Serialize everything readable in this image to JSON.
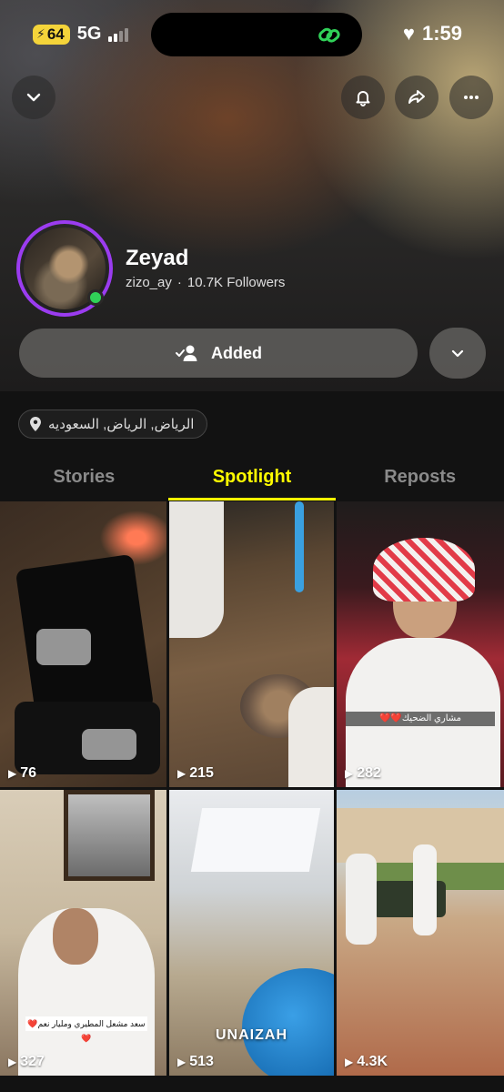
{
  "status_bar": {
    "battery": "64",
    "network": "5G",
    "time": "1:59"
  },
  "profile": {
    "name": "Zeyad",
    "username": "zizo_ay",
    "separator": "·",
    "followers": "10.7K Followers",
    "online": true
  },
  "actions": {
    "added_label": "Added"
  },
  "location": {
    "text": "الرياض, الرياض, السعوديه"
  },
  "tabs": [
    {
      "label": "Stories",
      "active": false
    },
    {
      "label": "Spotlight",
      "active": true
    },
    {
      "label": "Reposts",
      "active": false
    }
  ],
  "spotlight": [
    {
      "views": "76"
    },
    {
      "views": "215"
    },
    {
      "views": "282",
      "caption": "مشاري الضحيك❤️❤️"
    },
    {
      "views": "327",
      "caption": "سعد مشعل المطيري ومليار نعم❤️❤️"
    },
    {
      "views": "513",
      "caption": "UNAIZAH"
    },
    {
      "views": "4.3K"
    }
  ],
  "colors": {
    "accent": "#fffc00",
    "story_ring": "#9b3cf0",
    "online": "#30d158"
  }
}
